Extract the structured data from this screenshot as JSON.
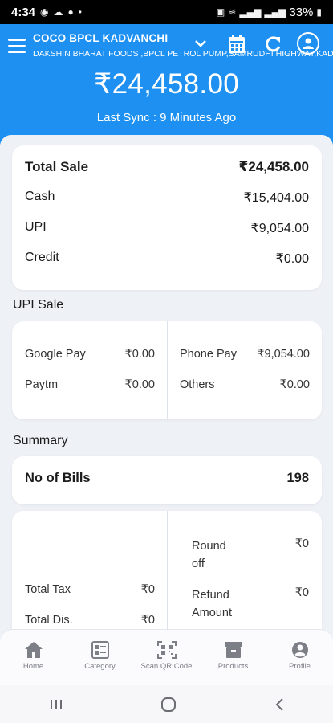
{
  "status_bar": {
    "time": "4:34",
    "battery": "33%"
  },
  "header": {
    "store_name": "COCO BPCL KADVANCHI",
    "store_subtitle": "DAKSHIN BHARAT FOODS ,BPCL PETROL PUMP,SAMRUDHI HIGHWAY,KADV",
    "total_amount": "₹24,458.00",
    "last_sync": "Last Sync : 9 Minutes Ago"
  },
  "totals": {
    "total_sale_label": "Total Sale",
    "total_sale_value": "₹24,458.00",
    "cash_label": "Cash",
    "cash_value": "₹15,404.00",
    "upi_label": "UPI",
    "upi_value": "₹9,054.00",
    "credit_label": "Credit",
    "credit_value": "₹0.00"
  },
  "upi_sale": {
    "title": "UPI Sale",
    "google_pay_label": "Google Pay",
    "google_pay_value": "₹0.00",
    "phone_pay_label": "Phone Pay",
    "phone_pay_value": "₹9,054.00",
    "paytm_label": "Paytm",
    "paytm_value": "₹0.00",
    "others_label": "Others",
    "others_value": "₹0.00"
  },
  "summary": {
    "title": "Summary",
    "bills_label": "No of Bills",
    "bills_value": "198",
    "total_tax_label": "Total Tax",
    "total_tax_value": "₹0",
    "total_dis_label": "Total Dis.",
    "total_dis_value": "₹0",
    "round_off_label_1": "Round",
    "round_off_label_2": "off",
    "round_off_value": "₹0",
    "refund_label_1": "Refund",
    "refund_label_2": "Amount",
    "refund_value": "₹0"
  },
  "bottom_nav": {
    "home": "Home",
    "category": "Category",
    "scan": "Scan QR Code",
    "products": "Products",
    "profile": "Profile"
  },
  "colors": {
    "primary": "#1e90f2",
    "background": "#eef1f6",
    "nav_icon": "#7d7f86"
  }
}
